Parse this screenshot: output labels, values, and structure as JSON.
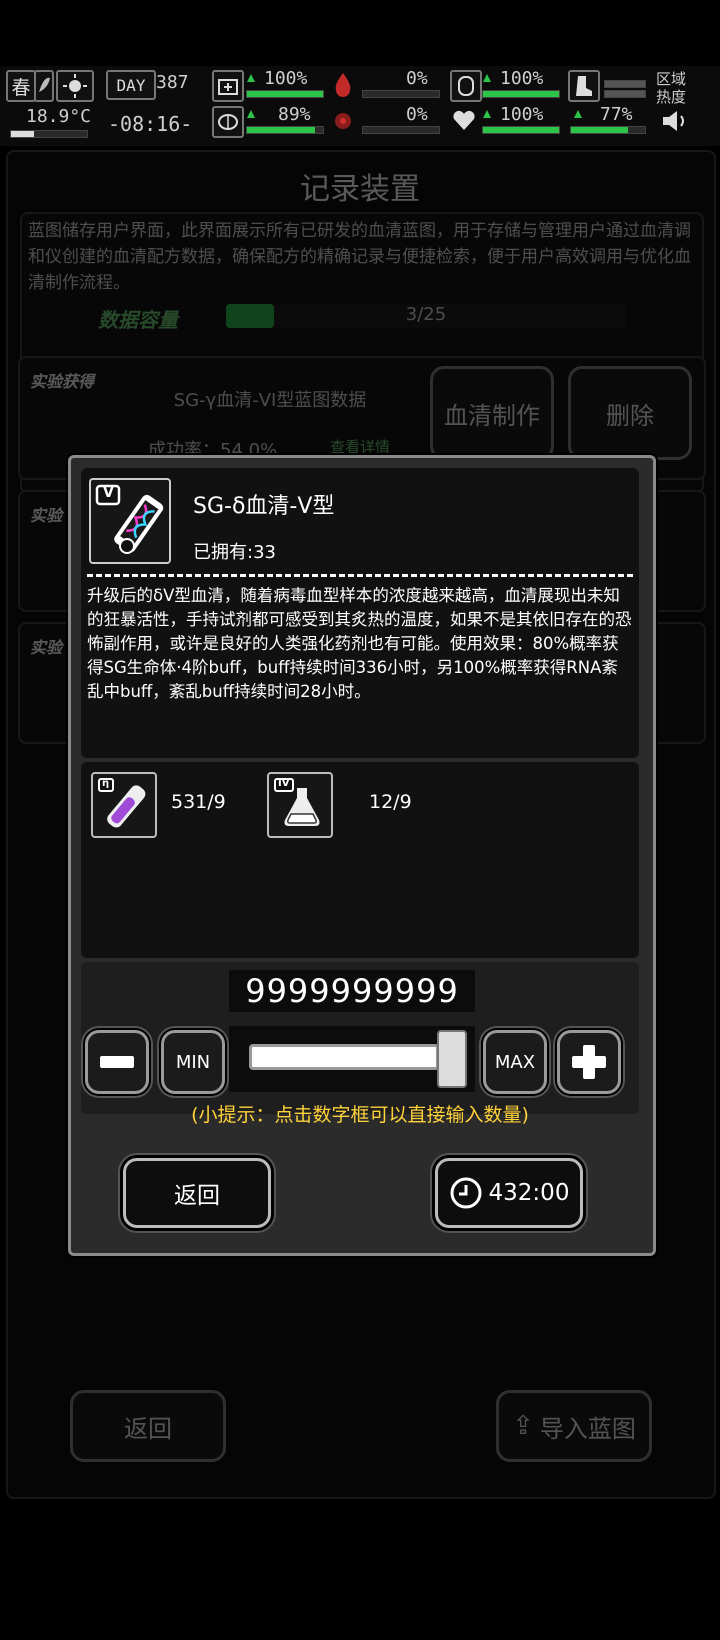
{
  "hud": {
    "season": "春",
    "temperature": "18.9°C",
    "day_label": "DAY",
    "day_number": "387",
    "time": "-08:16-",
    "health_pct": "100%",
    "blood_pct": "0%",
    "stomach_pct": "100%",
    "brain_pct": "89%",
    "virus_pct": "0%",
    "heart_pct": "100%",
    "stamina_pct": "77%",
    "region_heat_label": "区域热度"
  },
  "background_page": {
    "title": "记录装置",
    "description": "蓝图储存用户界面，此界面展示所有已研发的血清蓝图，用于存储与管理用户通过血清调和仪创建的血清配方数据，确保配方的精确记录与便捷检索，便于用户高效调用与优化血清制作流程。",
    "capacity_label": "数据容量",
    "capacity_value": "3/25",
    "entry": {
      "tag": "实验获得",
      "name": "SG-γ血清-VI型蓝图数据",
      "success_rate": "成功率：54.0%",
      "details_link": "查看详情",
      "make_button": "血清制作",
      "delete_button": "删除"
    },
    "tag2": "实验",
    "tag3": "实验",
    "back_button": "返回",
    "import_button": "导入蓝图"
  },
  "modal": {
    "item_badge": "V",
    "item_name": "SG-δ血清-V型",
    "owned": "已拥有:33",
    "description": "升级后的δV型血清，随着病毒血型样本的浓度越来越高，血清展现出未知的狂暴活性，手持试剂都可感受到其炙热的温度，如果不是其依旧存在的恐怖副作用，或许是良好的人类强化药剂也有可能。使用效果：80%概率获得SG生命体·4阶buff，buff持续时间336小时，另100%概率获得RNA紊乱中buff，紊乱buff持续时间28小时。",
    "ingredients": [
      {
        "badge": "η",
        "count": "531/9",
        "icon": "purple-vial-icon"
      },
      {
        "badge": "IV",
        "count": "12/9",
        "icon": "flask-icon"
      }
    ],
    "quantity": "9999999999",
    "min_label": "MIN",
    "max_label": "MAX",
    "slider_fraction": 1.0,
    "hint": "(小提示：点击数字框可以直接输入数量)",
    "back_button": "返回",
    "craft_time": "432:00"
  },
  "colors": {
    "hint_yellow": "#ffd23a",
    "green_bar": "#2ec44a",
    "red_bar": "#d03030"
  }
}
